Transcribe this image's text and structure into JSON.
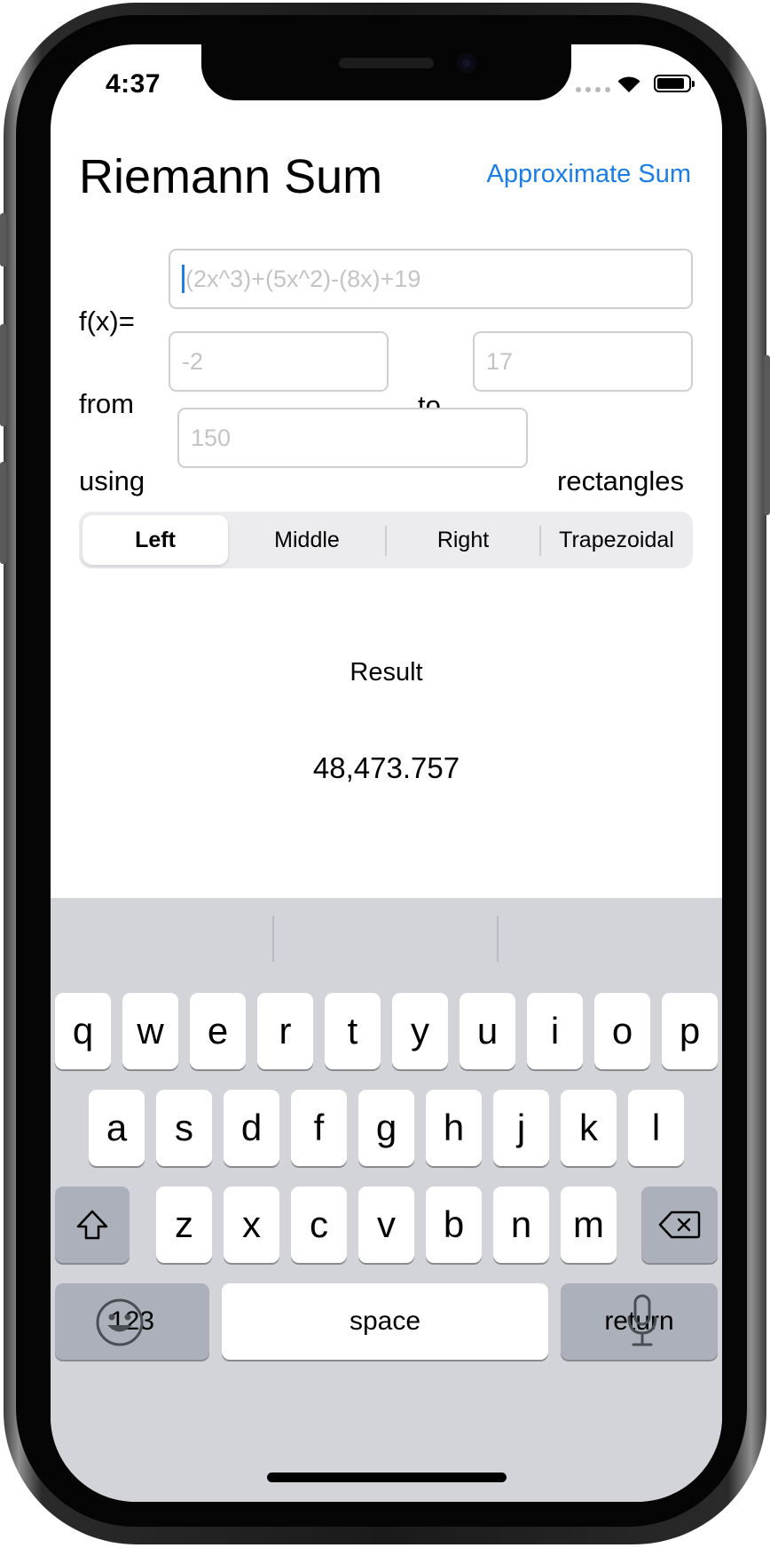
{
  "status_bar": {
    "time": "4:37"
  },
  "app": {
    "title": "Riemann Sum",
    "approximate_button": "Approximate Sum",
    "function_label": "f(x)=",
    "function_placeholder": "(2x^3)+(5x^2)-(8x)+19",
    "from_label": "from",
    "from_placeholder": "-2",
    "to_label": "to",
    "to_placeholder": "17",
    "using_label": "using",
    "using_placeholder": "150",
    "rectangles_label": "rectangles",
    "segments": [
      "Left",
      "Middle",
      "Right",
      "Trapezoidal"
    ],
    "selected_segment": "Left",
    "result_label": "Result",
    "result_value": "48,473.757"
  },
  "keyboard": {
    "row1": [
      "q",
      "w",
      "e",
      "r",
      "t",
      "y",
      "u",
      "i",
      "o",
      "p"
    ],
    "row2": [
      "a",
      "s",
      "d",
      "f",
      "g",
      "h",
      "j",
      "k",
      "l"
    ],
    "row3": [
      "z",
      "x",
      "c",
      "v",
      "b",
      "n",
      "m"
    ],
    "numbers_key": "123",
    "space_key": "space",
    "return_key": "return",
    "icons": [
      "shift-icon",
      "delete-icon",
      "emoji-icon",
      "microphone-icon"
    ]
  },
  "colors": {
    "accent": "#1a7ee6",
    "keyboard_bg": "#d2d4d9",
    "dark_key": "#abb0ba"
  }
}
